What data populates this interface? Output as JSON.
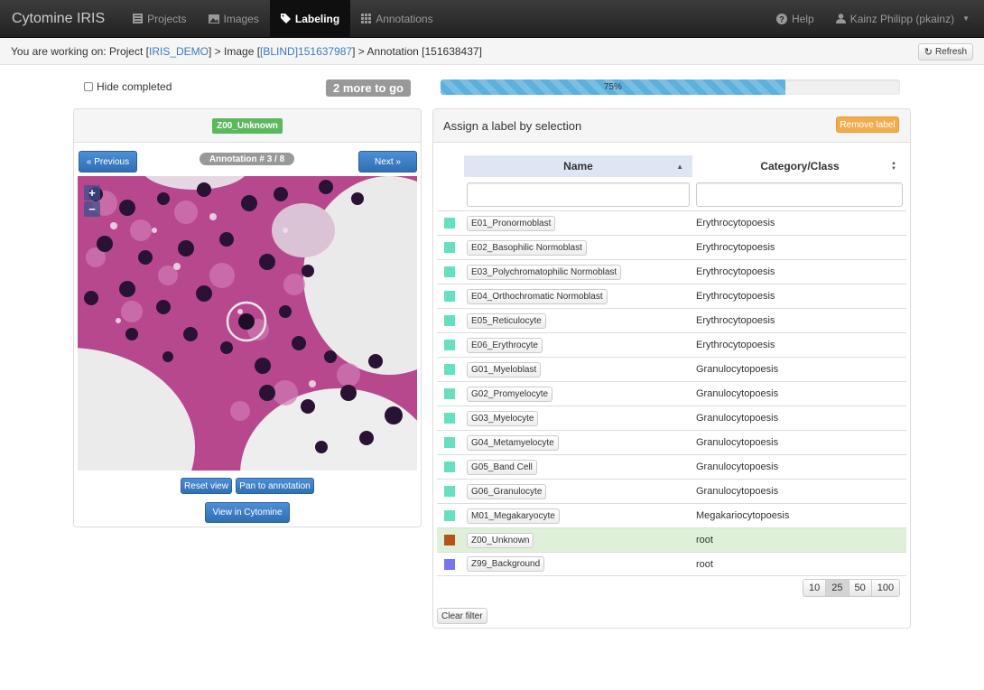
{
  "navbar": {
    "brand": "Cytomine IRIS",
    "items": [
      {
        "label": "Projects",
        "icon": "list-icon"
      },
      {
        "label": "Images",
        "icon": "picture-icon"
      },
      {
        "label": "Labeling",
        "icon": "tag-icon",
        "active": true
      },
      {
        "label": "Annotations",
        "icon": "grid-icon"
      }
    ],
    "help": "Help",
    "user": "Kainz Philipp (pkainz)"
  },
  "breadcrumb": {
    "prefix": "You are working on: Project [",
    "project": "IRIS_DEMO",
    "mid1": "] > Image [",
    "image": "[BLIND]151637987",
    "mid2": "] > Annotation [151638437]",
    "refresh": "Refresh"
  },
  "controls": {
    "hide_completed": "Hide completed",
    "more_to_go": "2 more to go",
    "progress_label": "75%",
    "progress": 0.75
  },
  "left_panel": {
    "current_label": "Z00_Unknown",
    "previous": "« Previous",
    "next": "Next »",
    "counter": "Annotation # 3 / 8",
    "zoom_in": "+",
    "zoom_out": "−",
    "reset_view": "Reset view",
    "pan_to_annotation": "Pan to annotation",
    "view_in_cytomine": "View in Cytomine"
  },
  "right_panel": {
    "title": "Assign a label by selection",
    "remove_label": "Remove label",
    "col_name": "Name",
    "col_category": "Category/Class",
    "rows": [
      {
        "name": "E01_Pronormoblast",
        "category": "Erythrocytopoesis",
        "color": "#66e0c0"
      },
      {
        "name": "E02_Basophilic Normoblast",
        "category": "Erythrocytopoesis",
        "color": "#66e0c0"
      },
      {
        "name": "E03_Polychromatophilic Normoblast",
        "category": "Erythrocytopoesis",
        "color": "#66e0c0"
      },
      {
        "name": "E04_Orthochromatic Normoblast",
        "category": "Erythrocytopoesis",
        "color": "#66e0c0"
      },
      {
        "name": "E05_Reticulocyte",
        "category": "Erythrocytopoesis",
        "color": "#66e0c0"
      },
      {
        "name": "E06_Erythrocyte",
        "category": "Erythrocytopoesis",
        "color": "#66e0c0"
      },
      {
        "name": "G01_Myeloblast",
        "category": "Granulocytopoesis",
        "color": "#66e0c0"
      },
      {
        "name": "G02_Promyelocyte",
        "category": "Granulocytopoesis",
        "color": "#66e0c0"
      },
      {
        "name": "G03_Myelocyte",
        "category": "Granulocytopoesis",
        "color": "#66e0c0"
      },
      {
        "name": "G04_Metamyelocyte",
        "category": "Granulocytopoesis",
        "color": "#66e0c0"
      },
      {
        "name": "G05_Band Cell",
        "category": "Granulocytopoesis",
        "color": "#66e0c0"
      },
      {
        "name": "G06_Granulocyte",
        "category": "Granulocytopoesis",
        "color": "#66e0c0"
      },
      {
        "name": "M01_Megakaryocyte",
        "category": "Megakariocytopoesis",
        "color": "#66e0c0"
      },
      {
        "name": "Z00_Unknown",
        "category": "root",
        "color": "#b5531e",
        "selected": true
      },
      {
        "name": "Z99_Background",
        "category": "root",
        "color": "#7b74f0"
      }
    ],
    "page_sizes": [
      "10",
      "25",
      "50",
      "100"
    ],
    "page_size_active": "25",
    "clear_filter": "Clear filter"
  }
}
